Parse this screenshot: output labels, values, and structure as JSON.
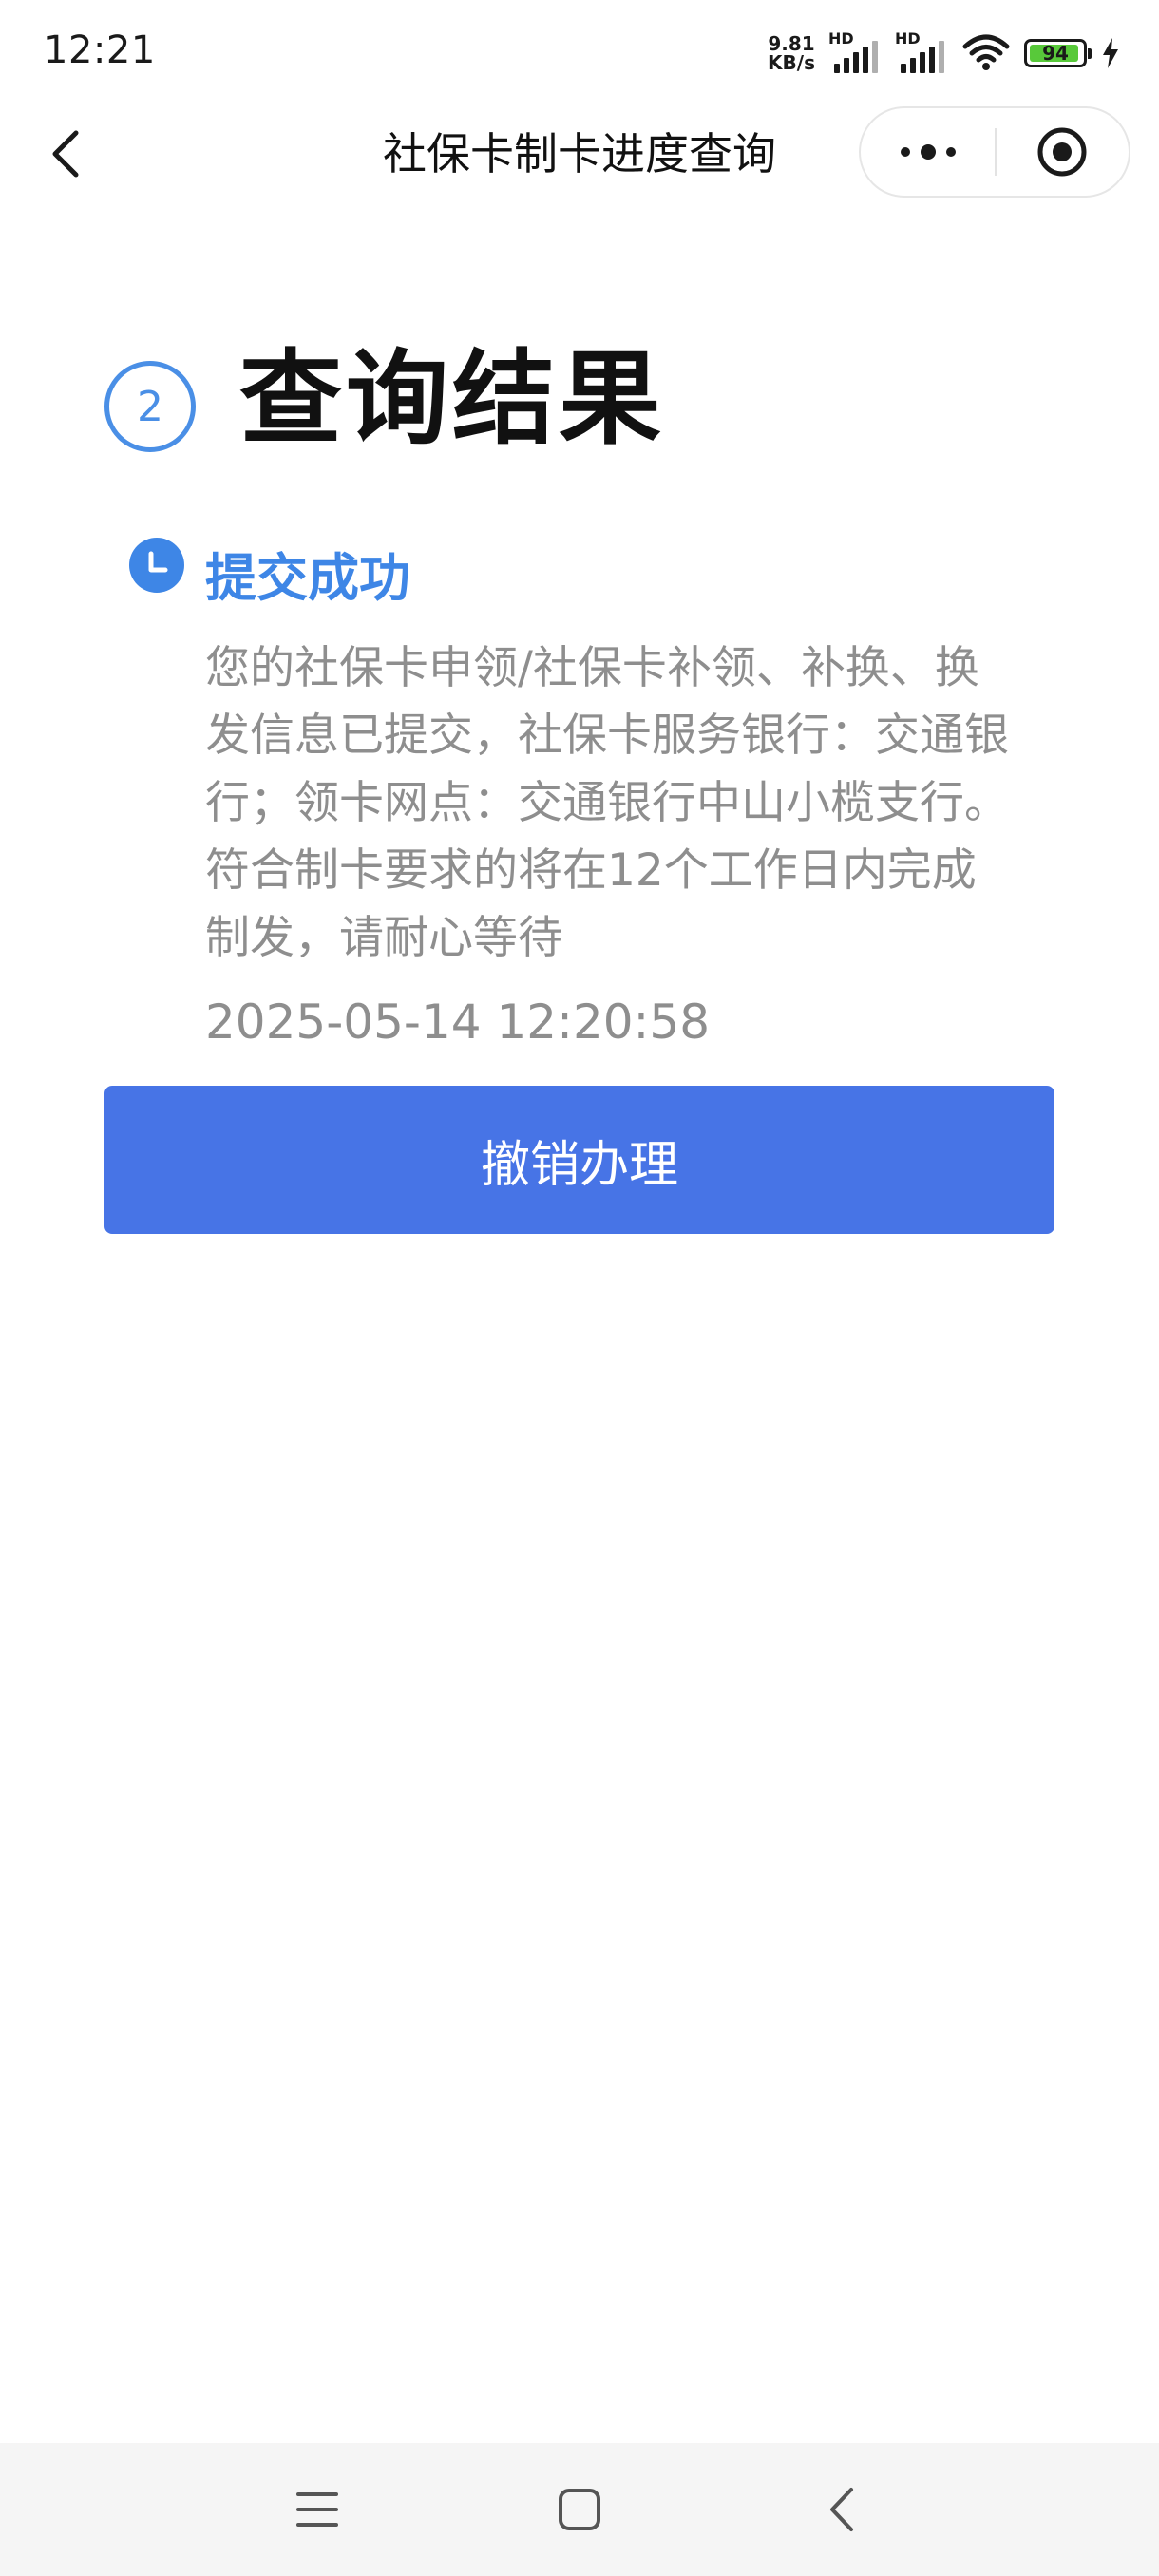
{
  "status_bar": {
    "time": "12:21",
    "net_speed_value": "9.81",
    "net_speed_unit": "KB/s",
    "hd_label_1": "HD",
    "hd_label_2": "HD",
    "battery_level": "94",
    "battery_fraction": 0.94,
    "battery_color": "#58c93a",
    "icons": [
      "signal-icon",
      "wifi-icon",
      "battery-icon",
      "charging-icon"
    ]
  },
  "nav": {
    "title": "社保卡制卡进度查询",
    "icons": [
      "back-icon",
      "more-dots-icon",
      "close-target-icon"
    ]
  },
  "step": {
    "number": "2",
    "title": "查询结果",
    "accent_color": "#4a8fe6"
  },
  "result": {
    "status_title": "提交成功",
    "status_icon": "clock-icon",
    "description": "您的社保卡申领/社保卡补领、补换、换发信息已提交，社保卡服务银行：交通银行；领卡网点：交通银行中山小榄支行。符合制卡要求的将在12个工作日内完成制发，请耐心等待",
    "timestamp": "2025-05-14 12:20:58",
    "title_color": "#3e86e6"
  },
  "actions": {
    "cancel_label": "撤销办理",
    "button_color": "#4774e6"
  },
  "system_nav": {
    "icons": [
      "menu-icon",
      "home-icon",
      "back-arrow-icon"
    ]
  }
}
